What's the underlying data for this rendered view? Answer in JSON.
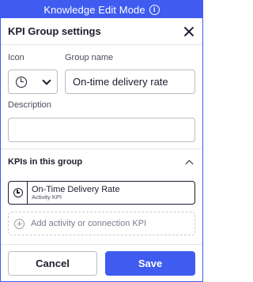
{
  "mode_bar": {
    "label": "Knowledge Edit Mode",
    "info_glyph": "i",
    "icon": "info-icon"
  },
  "dialog": {
    "title": "KPI Group settings",
    "close_icon": "close-icon"
  },
  "form": {
    "icon_label": "Icon",
    "icon_value": "clock-icon",
    "group_name_label": "Group name",
    "group_name_value": "On-time delivery rate",
    "description_label": "Description",
    "description_value": ""
  },
  "kpis": {
    "section_label": "KPIs in this group",
    "items": [
      {
        "name": "On-Time Delivery Rate",
        "type": "Activity KPI",
        "icon": "clock-icon"
      }
    ],
    "add_label": "Add activity or connection KPI"
  },
  "footer": {
    "cancel_label": "Cancel",
    "save_label": "Save"
  },
  "colors": {
    "accent": "#3f5bf0",
    "text": "#1b1d2e",
    "border": "#b9bcc8"
  }
}
